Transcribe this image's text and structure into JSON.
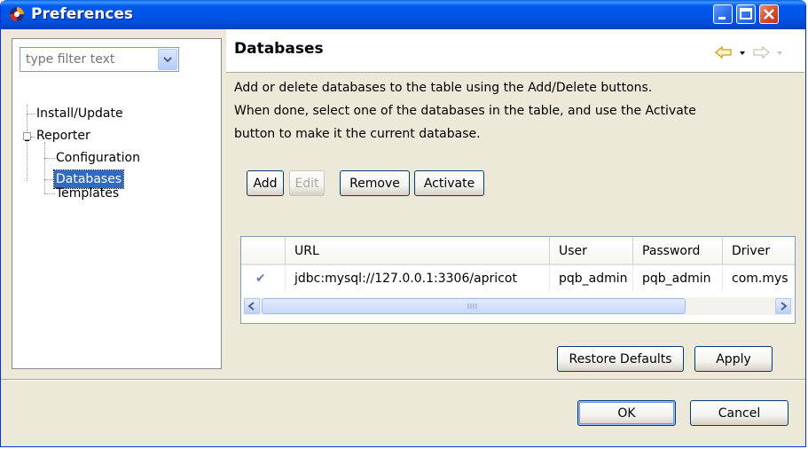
{
  "window": {
    "title": "Preferences"
  },
  "sidebar": {
    "filter_placeholder": "type filter text",
    "tree": [
      {
        "label": "Install/Update"
      },
      {
        "label": "Reporter",
        "expanded": true
      },
      {
        "label": "Configuration"
      },
      {
        "label": "Databases",
        "selected": true
      },
      {
        "label": "Templates"
      }
    ]
  },
  "page": {
    "title": "Databases",
    "description": [
      "Add or delete databases to the table using the Add/Delete buttons.",
      "When done, select one of the databases in the table, and use the Activate",
      "button to make it the current database."
    ],
    "buttons": {
      "add": "Add",
      "edit": "Edit",
      "remove": "Remove",
      "activate": "Activate"
    },
    "table": {
      "columns": [
        "",
        "URL",
        "User",
        "Password",
        "Driver"
      ],
      "rows": [
        {
          "active": "✔",
          "url": "jdbc:mysql://127.0.0.1:3306/apricot",
          "user": "pqb_admin",
          "password": "pqb_admin",
          "driver": "com.mys"
        }
      ]
    },
    "restore_defaults": "Restore Defaults",
    "apply": "Apply"
  },
  "footer": {
    "ok": "OK",
    "cancel": "Cancel"
  },
  "colors": {
    "title_bar": "#0054e3",
    "selection": "#316ac5",
    "close_button": "#d4492a",
    "dialog_bg": "#ece9d8"
  },
  "icons": [
    "eclipse-app-icon",
    "minimize-icon",
    "maximize-icon",
    "close-icon",
    "back-arrow-icon",
    "forward-arrow-icon",
    "chevron-down-icon",
    "checkmark-icon",
    "scroll-left-icon",
    "scroll-right-icon",
    "tree-collapse-icon"
  ]
}
